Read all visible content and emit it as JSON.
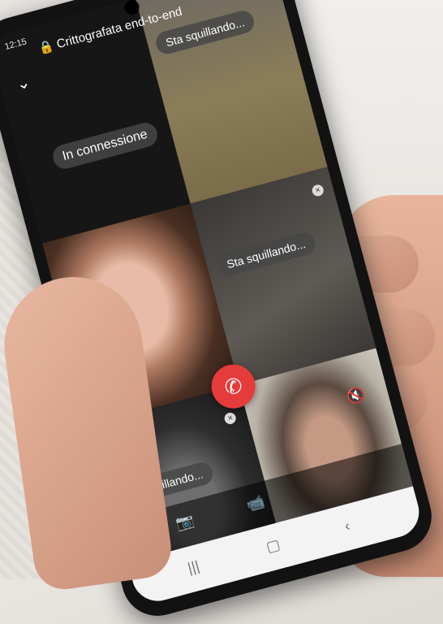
{
  "status_bar": {
    "time": "12:15"
  },
  "header": {
    "encryption_label": "Crittografata end-to-end"
  },
  "tiles": {
    "self_status": "In connessione",
    "ringing_1": "Sta squillando...",
    "ringing_2": "Sta squillando...",
    "ringing_3": "Sta squillando..."
  },
  "icons": {
    "collapse": "chevron-down-icon",
    "add_participant": "add-person-icon",
    "lock": "lock-icon",
    "hangup": "phone-hangup-icon",
    "switch_camera": "camera-switch-icon",
    "video_off": "video-off-icon",
    "mic_off": "mic-off-icon"
  },
  "colors": {
    "hangup": "#e53b3b",
    "phone_body": "#121212"
  }
}
